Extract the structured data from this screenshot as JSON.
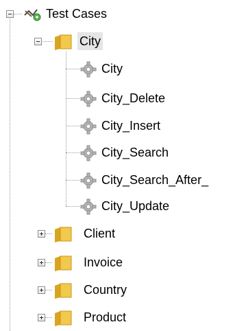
{
  "tree": {
    "root": {
      "label": "Test Cases",
      "icon": "test-cases-icon",
      "expanded": true,
      "children": [
        {
          "label": "City",
          "icon": "folder-icon",
          "expanded": true,
          "selected": true,
          "children": [
            {
              "label": "City",
              "icon": "gear-icon"
            },
            {
              "label": "City_Delete",
              "icon": "gear-icon"
            },
            {
              "label": "City_Insert",
              "icon": "gear-icon"
            },
            {
              "label": "City_Search",
              "icon": "gear-icon"
            },
            {
              "label": "City_Search_After_",
              "icon": "gear-icon"
            },
            {
              "label": "City_Update",
              "icon": "gear-icon"
            }
          ]
        },
        {
          "label": "Client",
          "icon": "folder-icon",
          "expanded": false
        },
        {
          "label": "Invoice",
          "icon": "folder-icon",
          "expanded": false
        },
        {
          "label": "Country",
          "icon": "folder-icon",
          "expanded": false
        },
        {
          "label": "Product",
          "icon": "folder-icon",
          "expanded": false
        }
      ]
    }
  },
  "colors": {
    "folder": "#f2c94c",
    "folder_dark": "#d9a520",
    "gear": "#b5b5b5",
    "selection": "#e5e5e5"
  }
}
